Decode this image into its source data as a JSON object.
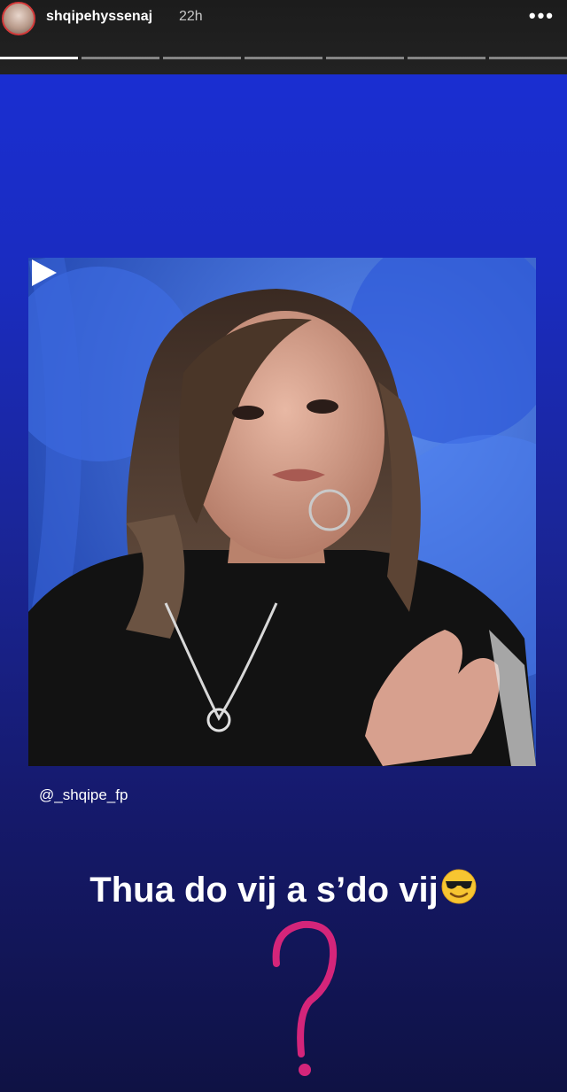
{
  "header": {
    "username": "shqipehyssenaj",
    "time": "22h",
    "more_label": "•••"
  },
  "progress": {
    "segments": 7,
    "active_index": 0
  },
  "media": {
    "credit": "@_shqipe_fp",
    "play_icon": "play-icon"
  },
  "caption": {
    "text": "Thua do vij a s’do vij",
    "emoji": "sunglasses-emoji"
  },
  "sticker": {
    "icon": "question-mark-sticker",
    "color": "#d4257a"
  },
  "colors": {
    "background_top": "#1a2fd8",
    "background_bottom": "#0f1244"
  }
}
